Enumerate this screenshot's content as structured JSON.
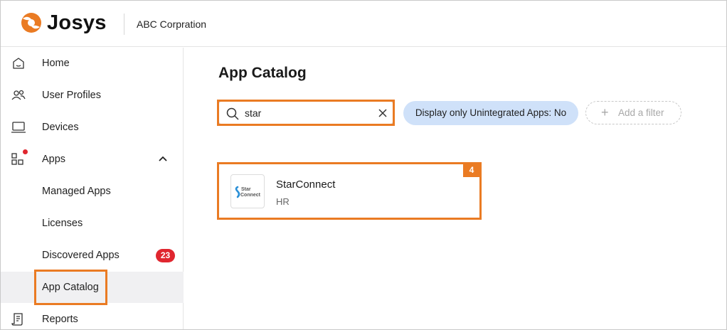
{
  "header": {
    "logo_text": "Josys",
    "org_name": "ABC Corpration"
  },
  "sidebar": {
    "items": [
      {
        "label": "Home",
        "icon": "home-icon"
      },
      {
        "label": "User Profiles",
        "icon": "users-icon"
      },
      {
        "label": "Devices",
        "icon": "laptop-icon"
      },
      {
        "label": "Apps",
        "icon": "apps-grid-icon",
        "expanded": true,
        "notification_dot": true
      },
      {
        "label": "Managed Apps"
      },
      {
        "label": "Licenses"
      },
      {
        "label": "Discovered Apps",
        "badge": "23"
      },
      {
        "label": "App Catalog",
        "active": true
      },
      {
        "label": "Reports",
        "icon": "report-icon"
      }
    ]
  },
  "main": {
    "title": "App Catalog",
    "search": {
      "value": "star"
    },
    "filter_chip": "Display only Unintegrated Apps: No",
    "add_filter": "Add a filter",
    "results": [
      {
        "name": "StarConnect",
        "category": "HR",
        "logo_text_line1": "Star",
        "logo_text_line2": "Connect",
        "step_number": "4"
      }
    ]
  },
  "colors": {
    "accent": "#ea7b23",
    "chip_bg": "#cfe1f9",
    "badge_red": "#e0262f",
    "active_bg": "#f0f0f2"
  }
}
